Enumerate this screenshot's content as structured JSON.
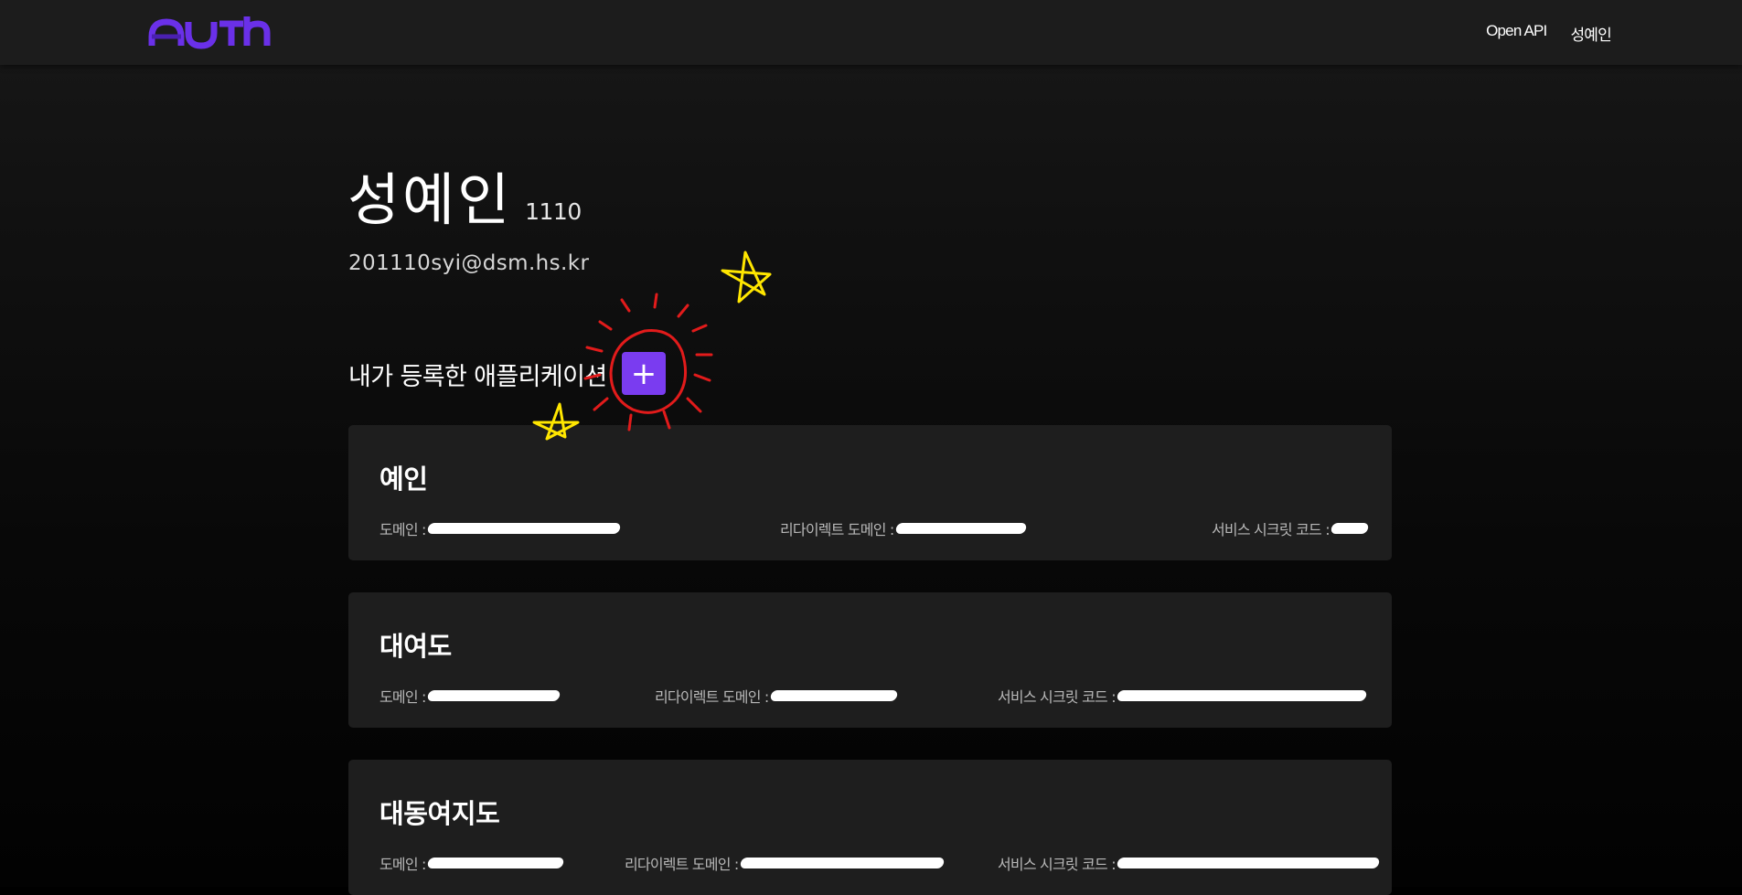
{
  "header": {
    "logo_text": "AUTH",
    "nav": [
      {
        "label": "Open API"
      },
      {
        "label": "성예인"
      }
    ]
  },
  "profile": {
    "name": "성예인",
    "number": "1110",
    "email": "201110syi@dsm.hs.kr"
  },
  "apps_section": {
    "title": "내가 등록한 애플리케이션",
    "add_label": "+"
  },
  "field_labels": {
    "domain": "도메인 :",
    "redirect_domain": "리다이렉트 도메인 :",
    "secret_code": "서비스 시크릿 코드 :"
  },
  "apps": [
    {
      "name": "예인",
      "domain": "",
      "redirect_domain": "",
      "secret_code": ""
    },
    {
      "name": "대여도",
      "domain": "",
      "redirect_domain": "",
      "secret_code": ""
    },
    {
      "name": "대동여지도",
      "domain": "",
      "redirect_domain": "",
      "secret_code": ""
    }
  ],
  "colors": {
    "background": "#000000",
    "topbar": "#1c1c1c",
    "card": "#1e1e1e",
    "accent": "#7a3cf0",
    "logo": "#6a30e8",
    "annotation_red": "#e21b1b",
    "annotation_yellow": "#ffe600"
  }
}
